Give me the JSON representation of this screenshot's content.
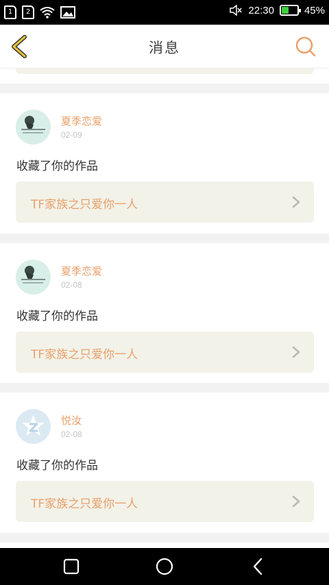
{
  "status_bar": {
    "sim1": "1",
    "sim2": "2",
    "time": "22:30",
    "battery_text": "45%",
    "battery_level": 0.45
  },
  "header": {
    "title": "消息"
  },
  "messages": [
    {
      "username": "夏季恋爱",
      "date": "02-09",
      "action": "收藏了你的作品",
      "work_title": "TF家族之只爱你一人"
    },
    {
      "username": "夏季恋爱",
      "date": "02-08",
      "action": "收藏了你的作品",
      "work_title": "TF家族之只爱你一人"
    },
    {
      "username": "悦汝",
      "date": "02-08",
      "action": "收藏了你的作品",
      "work_title": "TF家族之只爱你一人"
    }
  ],
  "colors": {
    "accent": "#e9a069",
    "back_icon": "#e8c43a",
    "link_background": "#f2f2e9",
    "battery_fill": "#3fcf3f"
  },
  "icons": {
    "back": "chevron-left-icon",
    "search": "search-icon",
    "link_arrow": "chevron-right-icon",
    "nav_recent": "square-icon",
    "nav_home": "circle-icon",
    "nav_back": "triangle-left-icon"
  }
}
